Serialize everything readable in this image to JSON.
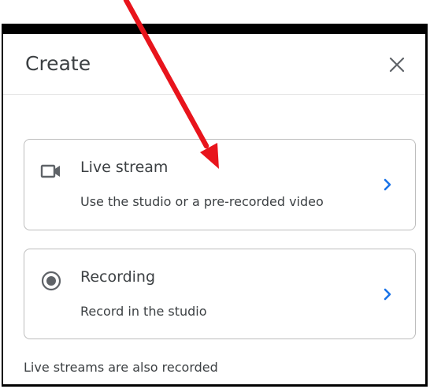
{
  "dialog": {
    "title": "Create",
    "options": [
      {
        "title": "Live stream",
        "description": "Use the studio or a pre-recorded video",
        "icon": "video-camera-icon"
      },
      {
        "title": "Recording",
        "description": "Record in the studio",
        "icon": "radio-button-icon"
      }
    ],
    "footnote": "Live streams are also recorded"
  },
  "colors": {
    "accent": "#1a73e8",
    "text": "#3c4043",
    "annotation": "#e8141c"
  }
}
